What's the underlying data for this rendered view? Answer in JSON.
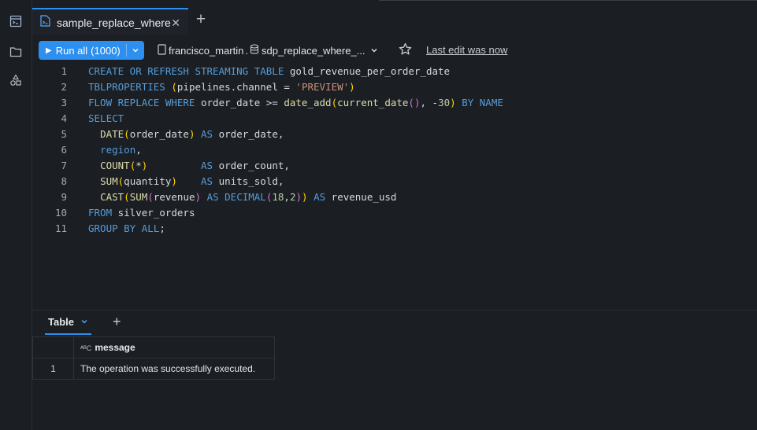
{
  "tab": {
    "title": "sample_replace_where"
  },
  "toolbar": {
    "run_label": "Run all",
    "run_count": "(1000)",
    "catalog": "francisco_martin",
    "schema": "sdp_replace_where_...",
    "last_edit": "Last edit was now"
  },
  "editor": {
    "line_numbers": [
      "1",
      "2",
      "3",
      "4",
      "5",
      "6",
      "7",
      "8",
      "9",
      "10",
      "11"
    ]
  },
  "results": {
    "tab_label": "Table",
    "column_header": "message",
    "rows": [
      {
        "index": "1",
        "message": "The operation was successfully executed."
      }
    ]
  },
  "colors": {
    "accent": "#2d8ff0",
    "background": "#1b1e23",
    "keyword": "#569cd6",
    "function": "#dcdcaa",
    "string": "#ce9178"
  }
}
